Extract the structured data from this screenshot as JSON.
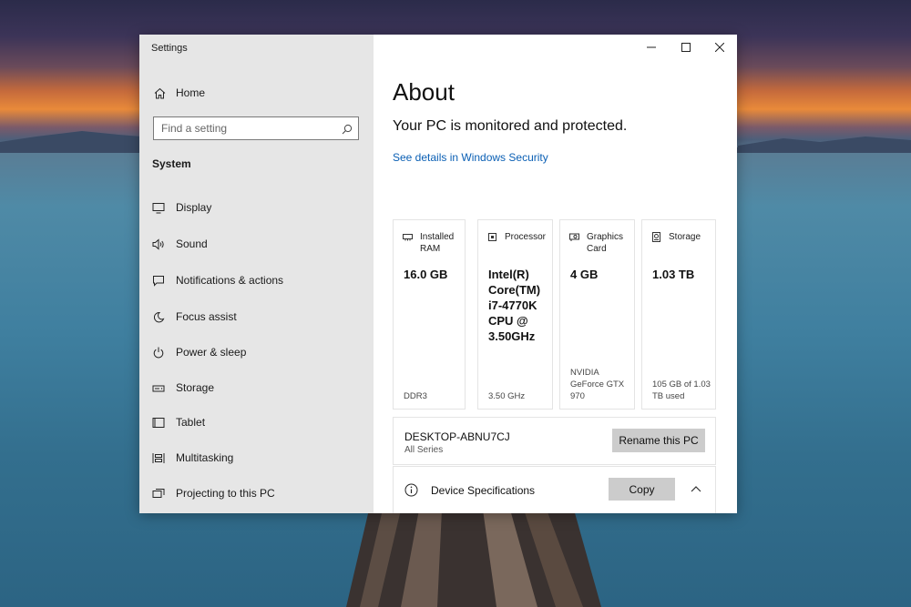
{
  "window": {
    "title": "Settings"
  },
  "sidebar": {
    "home_label": "Home",
    "search": {
      "placeholder": "Find a setting"
    },
    "section_label": "System",
    "items": [
      {
        "label": "Display",
        "icon": "monitor-icon"
      },
      {
        "label": "Sound",
        "icon": "speaker-icon"
      },
      {
        "label": "Notifications & actions",
        "icon": "notification-icon"
      },
      {
        "label": "Focus assist",
        "icon": "moon-icon"
      },
      {
        "label": "Power & sleep",
        "icon": "power-icon"
      },
      {
        "label": "Storage",
        "icon": "storage-icon"
      },
      {
        "label": "Tablet",
        "icon": "tablet-icon"
      },
      {
        "label": "Multitasking",
        "icon": "multitasking-icon"
      },
      {
        "label": "Projecting to this PC",
        "icon": "projecting-icon"
      }
    ]
  },
  "main": {
    "title": "About",
    "status": "Your PC is monitored and protected.",
    "security_link": "See details in Windows Security",
    "cards": [
      {
        "header": "Installed RAM",
        "value": "16.0 GB",
        "sub": "DDR3",
        "icon": "ram-icon"
      },
      {
        "header": "Processor",
        "value": "Intel(R) Core(TM) i7-4770K CPU @ 3.50GHz",
        "sub": "3.50 GHz",
        "icon": "cpu-icon"
      },
      {
        "header": "Graphics Card",
        "value": "4 GB",
        "sub": "NVIDIA GeForce GTX 970",
        "icon": "gpu-icon"
      },
      {
        "header": "Storage",
        "value": "1.03 TB",
        "sub": "105 GB of 1.03 TB used",
        "icon": "disk-icon"
      }
    ],
    "pc_name": "DESKTOP-ABNU7CJ",
    "pc_series": "All Series",
    "rename_button": "Rename this PC",
    "specs_label": "Device Specifications",
    "copy_button": "Copy"
  },
  "colors": {
    "sidebar_bg": "#e6e6e6",
    "link": "#0a5fb4",
    "button_bg": "#cccccc"
  }
}
